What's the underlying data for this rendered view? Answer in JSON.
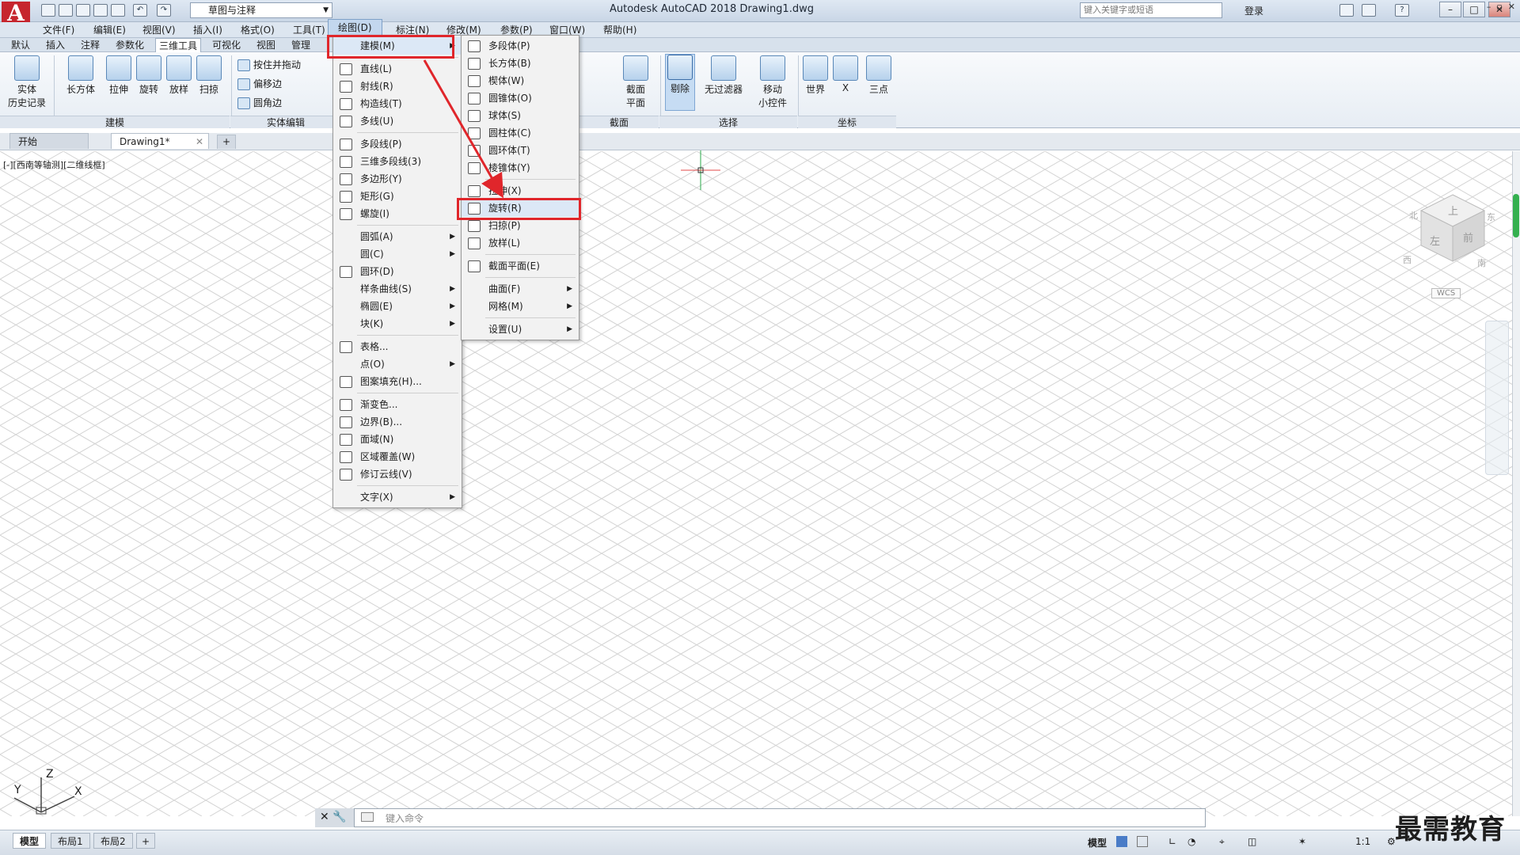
{
  "titlebar": {
    "workspace": "草图与注释",
    "title": "Autodesk AutoCAD 2018    Drawing1.dwg",
    "search_placeholder": "键入关键字或短语",
    "login": "登录"
  },
  "menubar": [
    "文件(F)",
    "编辑(E)",
    "视图(V)",
    "插入(I)",
    "格式(O)",
    "工具(T)",
    "绘图(D)",
    "标注(N)",
    "修改(M)",
    "参数(P)",
    "窗口(W)",
    "帮助(H)"
  ],
  "ribbon_tabs": [
    "默认",
    "插入",
    "注释",
    "参数化",
    "三维工具",
    "可视化",
    "视图",
    "管理"
  ],
  "ribbon": {
    "history_l1": "实体",
    "history_l2": "历史记录",
    "box": "长方体",
    "extrude": "拉伸",
    "revolve": "旋转",
    "loft": "放样",
    "sweep": "扫掠",
    "presspull": "按住并拖动",
    "offset_edge": "偏移边",
    "fillet_edge": "圆角边",
    "section_l1": "截面",
    "section_l2": "平面",
    "cull": "剔除",
    "nofilter": "无过滤器",
    "gizmo_l1": "移动",
    "gizmo_l2": "小控件",
    "world": "世界",
    "x": "X",
    "three_point": "三点",
    "panel_modeling": "建模",
    "panel_solid_edit": "实体编辑",
    "panel_section": "截面",
    "panel_select": "选择",
    "panel_coord": "坐标"
  },
  "file_tabs": {
    "start": "开始",
    "drawing": "Drawing1*"
  },
  "viewport_label": "[-][西南等轴测][二维线框]",
  "viewcube": {
    "top": "上",
    "left": "左",
    "front": "前",
    "w": "西",
    "s": "南",
    "e": "东",
    "n": "北",
    "wcs": "WCS"
  },
  "ucs": {
    "x": "X",
    "y": "Y",
    "z": "Z"
  },
  "draw_menu": [
    {
      "label": "建模(M)",
      "icon": "",
      "sub": true,
      "hl": true
    },
    {
      "sep": true
    },
    {
      "label": "直线(L)",
      "icon": "line-icon"
    },
    {
      "label": "射线(R)",
      "icon": "ray-icon"
    },
    {
      "label": "构造线(T)",
      "icon": "xline-icon"
    },
    {
      "label": "多线(U)",
      "icon": "mline-icon"
    },
    {
      "sep": true
    },
    {
      "label": "多段线(P)",
      "icon": "polyline-icon"
    },
    {
      "label": "三维多段线(3)",
      "icon": "3dpolyline-icon"
    },
    {
      "label": "多边形(Y)",
      "icon": "polygon-icon"
    },
    {
      "label": "矩形(G)",
      "icon": "rectangle-icon"
    },
    {
      "label": "螺旋(I)",
      "icon": "helix-icon"
    },
    {
      "sep": true
    },
    {
      "label": "圆弧(A)",
      "sub": true
    },
    {
      "label": "圆(C)",
      "sub": true
    },
    {
      "label": "圆环(D)",
      "icon": "donut-icon"
    },
    {
      "label": "样条曲线(S)",
      "sub": true
    },
    {
      "label": "椭圆(E)",
      "sub": true
    },
    {
      "label": "块(K)",
      "sub": true
    },
    {
      "sep": true
    },
    {
      "label": "表格...",
      "icon": "table-icon"
    },
    {
      "label": "点(O)",
      "sub": true
    },
    {
      "label": "图案填充(H)...",
      "icon": "hatch-icon"
    },
    {
      "sep": true
    },
    {
      "label": "渐变色...",
      "icon": "gradient-icon"
    },
    {
      "label": "边界(B)...",
      "icon": "boundary-icon"
    },
    {
      "label": "面域(N)",
      "icon": "region-icon"
    },
    {
      "label": "区域覆盖(W)",
      "icon": "wipeout-icon"
    },
    {
      "label": "修订云线(V)",
      "icon": "revcloud-icon"
    },
    {
      "sep": true
    },
    {
      "label": "文字(X)",
      "sub": true
    }
  ],
  "modeling_menu": [
    {
      "label": "多段体(P)",
      "icon": "polysolid-icon"
    },
    {
      "label": "长方体(B)",
      "icon": "box-icon"
    },
    {
      "label": "楔体(W)",
      "icon": "wedge-icon"
    },
    {
      "label": "圆锥体(O)",
      "icon": "cone-icon"
    },
    {
      "label": "球体(S)",
      "icon": "sphere-icon"
    },
    {
      "label": "圆柱体(C)",
      "icon": "cylinder-icon"
    },
    {
      "label": "圆环体(T)",
      "icon": "torus-icon"
    },
    {
      "label": "棱锥体(Y)",
      "icon": "pyramid-icon"
    },
    {
      "sep": true
    },
    {
      "label": "拉伸(X)",
      "icon": "extrude-icon"
    },
    {
      "label": "旋转(R)",
      "icon": "revolve-icon",
      "hl": true
    },
    {
      "label": "扫掠(P)",
      "icon": "sweep-icon"
    },
    {
      "label": "放样(L)",
      "icon": "loft-icon"
    },
    {
      "sep": true
    },
    {
      "label": "截面平面(E)",
      "icon": "section-plane-icon"
    },
    {
      "sep": true
    },
    {
      "label": "曲面(F)",
      "sub": true
    },
    {
      "label": "网格(M)",
      "sub": true
    },
    {
      "sep": true
    },
    {
      "label": "设置(U)",
      "sub": true
    }
  ],
  "cmdline": {
    "placeholder": "键入命令"
  },
  "layout_tabs": [
    "模型",
    "布局1",
    "布局2"
  ],
  "status": {
    "model": "模型",
    "scale": "1:1"
  },
  "watermark": "最需教育",
  "colors": {
    "highlight_red": "#e0262b",
    "accent": "#34b04f"
  }
}
